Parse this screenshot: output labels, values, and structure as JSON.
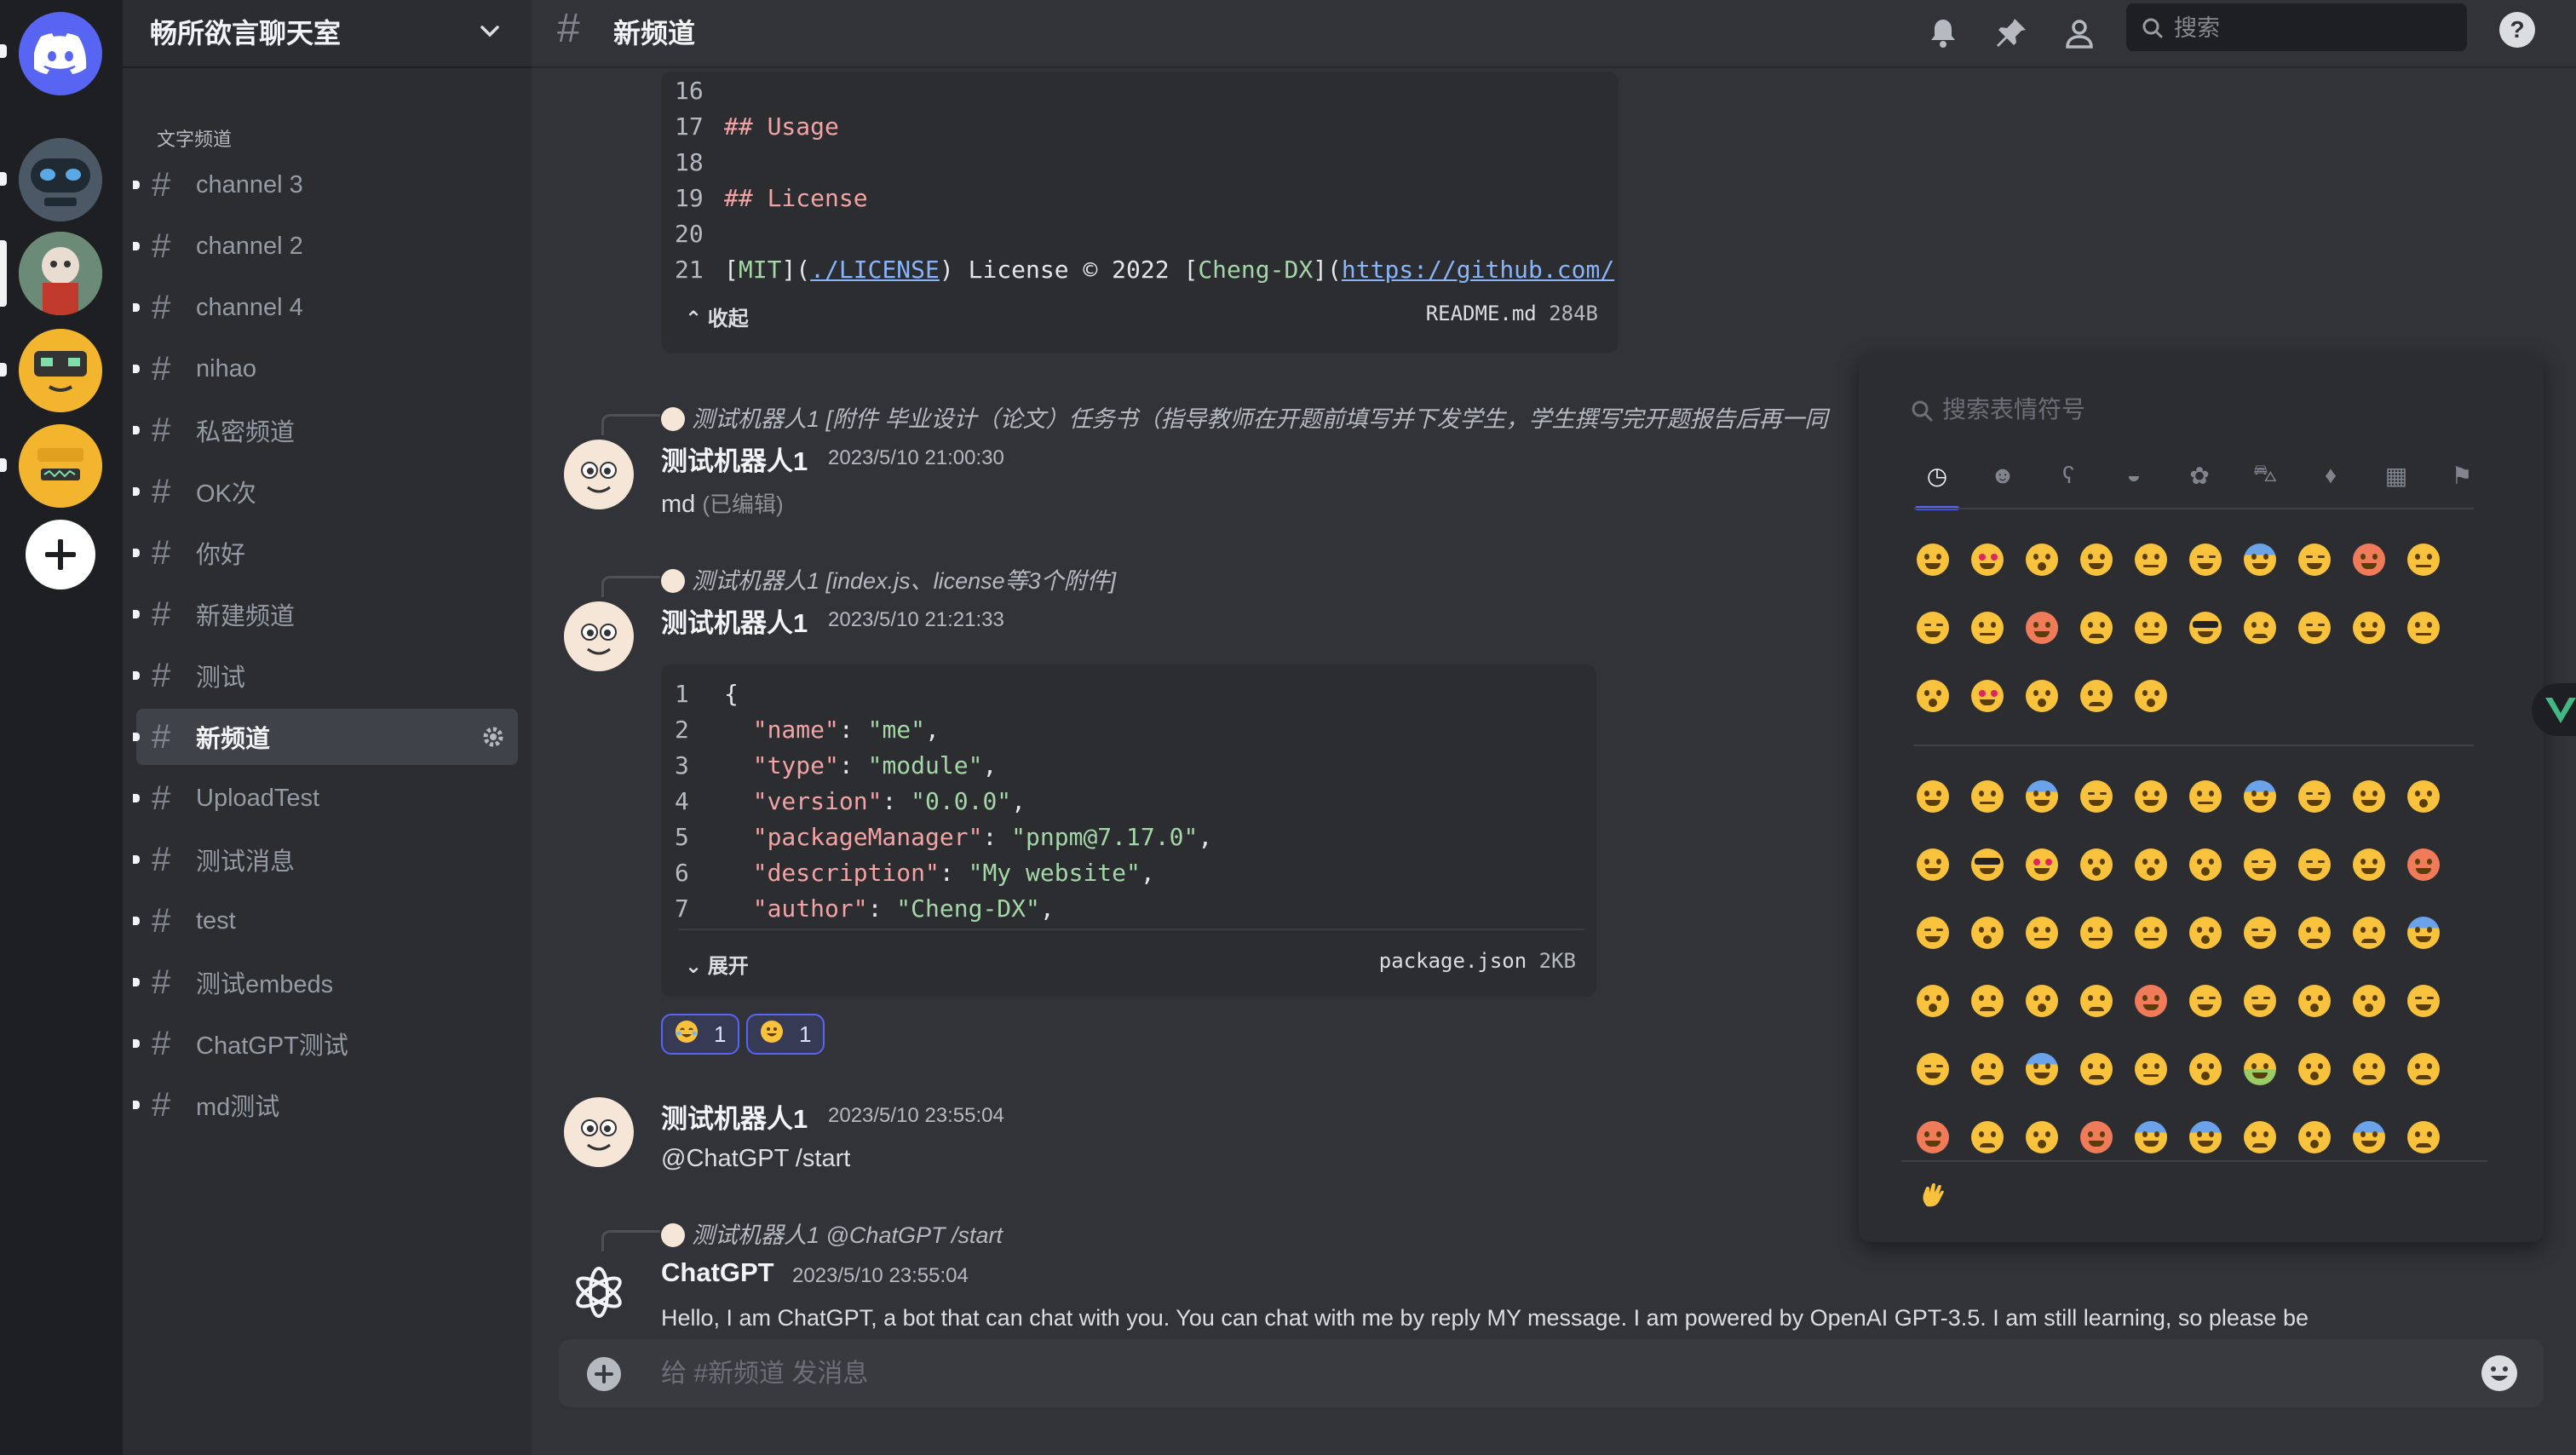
{
  "server": {
    "name": "畅所欲言聊天室",
    "category": "文字频道"
  },
  "rail": {
    "home_icon": "discord-logo-icon",
    "add_icon": "plus-icon"
  },
  "channels": [
    {
      "name": "channel 3"
    },
    {
      "name": "channel 2"
    },
    {
      "name": "channel 4"
    },
    {
      "name": "nihao"
    },
    {
      "name": "私密频道"
    },
    {
      "name": "OK次"
    },
    {
      "name": "你好"
    },
    {
      "name": "新建频道"
    },
    {
      "name": "测试"
    },
    {
      "name": "新频道"
    },
    {
      "name": "UploadTest"
    },
    {
      "name": "测试消息"
    },
    {
      "name": "test"
    },
    {
      "name": "测试embeds"
    },
    {
      "name": "ChatGPT测试"
    },
    {
      "name": "md测试"
    }
  ],
  "active_channel": "新频道",
  "topbar": {
    "hash": "#",
    "title": "新频道",
    "search_placeholder": "搜索"
  },
  "readme_block": {
    "lines": [
      {
        "n": "16",
        "text": ""
      },
      {
        "n": "17",
        "text": "## Usage"
      },
      {
        "n": "18",
        "text": ""
      },
      {
        "n": "19",
        "text": "## License"
      },
      {
        "n": "20",
        "text": ""
      },
      {
        "n": "21",
        "text": "[MIT](./LICENSE) License © 2022 [Cheng-DX](https://github.com/"
      }
    ],
    "line21": {
      "a": "[",
      "b": "MIT",
      "c": "](",
      "d": "./LICENSE",
      "e": ") License © 2022 [",
      "f": "Cheng-DX",
      "g": "](",
      "h": "https://github.com/"
    },
    "toggle": "收起",
    "filename": "README.md",
    "size": "284B"
  },
  "messages": [
    {
      "reply": "测试机器人1 [附件 毕业设计（论文）任务书（指导教师在开题前填写并下发学生，学生撰写完开题报告后再一同",
      "author": "测试机器人1",
      "time": "2023/5/10 21:00:30",
      "text": "md",
      "edited": "(已编辑)"
    },
    {
      "reply": "测试机器人1 [index.js、license等3个附件]",
      "author": "测试机器人1",
      "time": "2023/5/10 21:21:33"
    },
    {
      "author": "测试机器人1",
      "time": "2023/5/10 23:55:04",
      "text": "@ChatGPT /start"
    },
    {
      "reply": "测试机器人1 @ChatGPT /start",
      "author": "ChatGPT",
      "time": "2023/5/10 23:55:04",
      "text": "Hello, I am ChatGPT, a bot that can chat with you. You can chat with me by reply MY message. I am powered by OpenAI GPT-3.5. I am still learning, so please be"
    }
  ],
  "package_block": {
    "lines": [
      {
        "n": "1",
        "p": "{"
      },
      {
        "n": "2",
        "k": "\"name\"",
        "v": "\"me\""
      },
      {
        "n": "3",
        "k": "\"type\"",
        "v": "\"module\""
      },
      {
        "n": "4",
        "k": "\"version\"",
        "v": "\"0.0.0\""
      },
      {
        "n": "5",
        "k": "\"packageManager\"",
        "v": "\"pnpm@7.17.0\""
      },
      {
        "n": "6",
        "k": "\"description\"",
        "v": "\"My website\""
      },
      {
        "n": "7",
        "k": "\"author\"",
        "v": "\"Cheng-DX\""
      }
    ],
    "toggle": "展开",
    "filename": "package.json",
    "size": "2KB"
  },
  "reactions": [
    {
      "emoji": "joy-face-icon",
      "count": "1"
    },
    {
      "emoji": "grin-face-icon",
      "count": "1"
    }
  ],
  "composer": {
    "placeholder": "给 #新频道 发消息"
  },
  "emoji_picker": {
    "search_placeholder": "搜索表情符号",
    "categories": [
      "clock-icon",
      "smiley-icon",
      "bear-icon",
      "burger-icon",
      "soccer-icon",
      "car-icon",
      "bulb-icon",
      "symbols-icon",
      "flag-icon"
    ],
    "recent_count": 25,
    "people_rows": 6,
    "footer_emoji": "waving-hand-icon"
  },
  "colors": {
    "accent": "#5865f2",
    "background": "#313338",
    "sidebar": "#2b2d31",
    "rail": "#1e1f22",
    "string_green": "#a5d6a7",
    "heading_red": "#f3a3a3"
  }
}
